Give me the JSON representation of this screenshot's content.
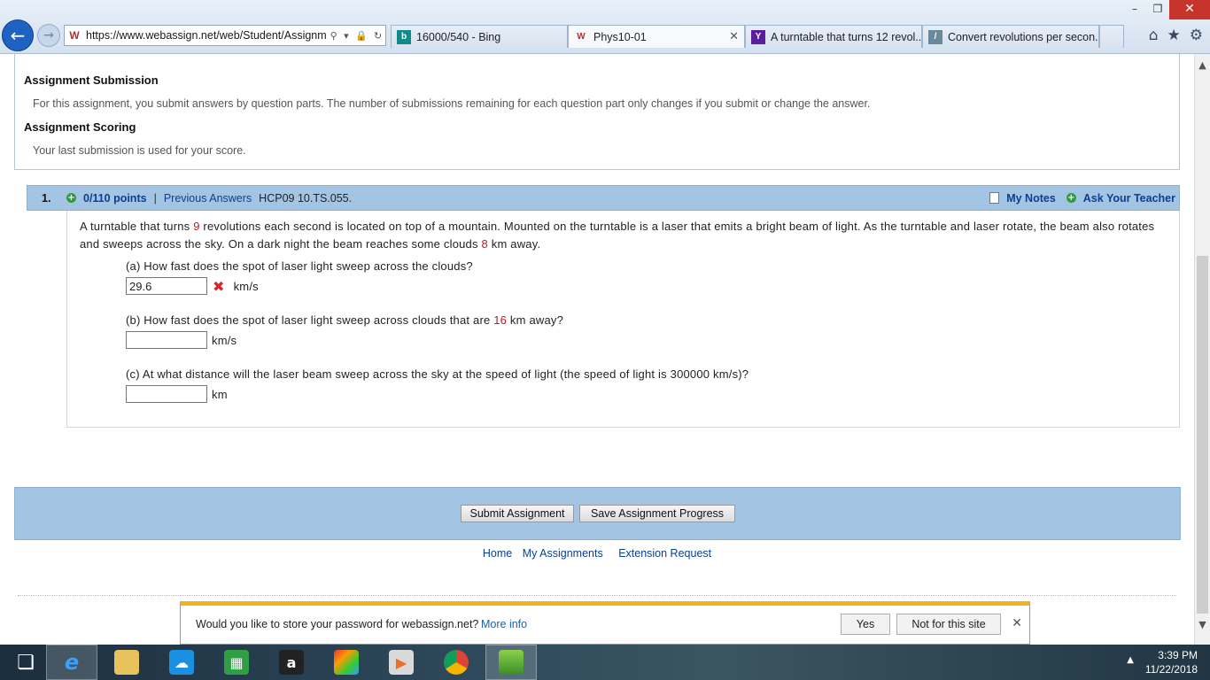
{
  "browser": {
    "url": "https://www.webassign.net/web/Student/Assignm",
    "tabs": [
      {
        "title": "16000/540 - Bing",
        "icon": "bing-icon"
      },
      {
        "title": "Phys10-01",
        "icon": "webassign-icon",
        "active": true
      },
      {
        "title": "A turntable that turns 12 revol...",
        "icon": "yahoo-icon"
      },
      {
        "title": "Convert revolutions per secon...",
        "icon": "site-icon"
      }
    ]
  },
  "info": {
    "submission_title": "Assignment Submission",
    "submission_text": "For this assignment, you submit answers by question parts. The number of submissions remaining for each question part only changes if you submit or change the answer.",
    "scoring_title": "Assignment Scoring",
    "scoring_text": "Your last submission is used for your score."
  },
  "question": {
    "number": "1.",
    "points": "0/110 points",
    "separator": "|",
    "previous_answers": "Previous Answers",
    "code": "HCP09 10.TS.055.",
    "my_notes": "My Notes",
    "ask_teacher": "Ask Your Teacher",
    "text": {
      "t1": "A turntable that turns ",
      "v1": "9",
      "t2": " revolutions each second is located on top of a mountain. Mounted on the turntable is a laser that emits a bright beam of light. As the turntable and laser rotate, the beam also rotates and sweeps across the sky. On a dark night the beam reaches some clouds ",
      "v2": "8",
      "t3": " km away."
    },
    "parts": {
      "a": {
        "question": "(a) How fast does the spot of laser light sweep across the clouds?",
        "value": "29.6",
        "unit": "km/s"
      },
      "b": {
        "q1": "(b) How fast does the spot of laser light sweep across clouds that are ",
        "v": "16",
        "q2": " km away?",
        "value": "",
        "unit": "km/s"
      },
      "c": {
        "question": "(c) At what distance will the laser beam sweep across the sky at the speed of light (the speed of light is 300000 km/s)?",
        "value": "",
        "unit": "km"
      }
    }
  },
  "actions": {
    "submit": "Submit Assignment",
    "save": "Save Assignment Progress"
  },
  "footer": {
    "home": "Home",
    "my_assignments": "My Assignments",
    "extension": "Extension Request"
  },
  "password_bar": {
    "message": "Would you like to store your password for webassign.net?",
    "more_info": "More info",
    "yes": "Yes",
    "not_for_site": "Not for this site"
  },
  "taskbar": {
    "time": "3:39 PM",
    "date": "11/22/2018"
  },
  "colors": {
    "header_blue": "#a4c4e4",
    "link_blue": "#0a3f92",
    "value_red": "#c8171c",
    "notification_yellow": "#f2b21b"
  }
}
